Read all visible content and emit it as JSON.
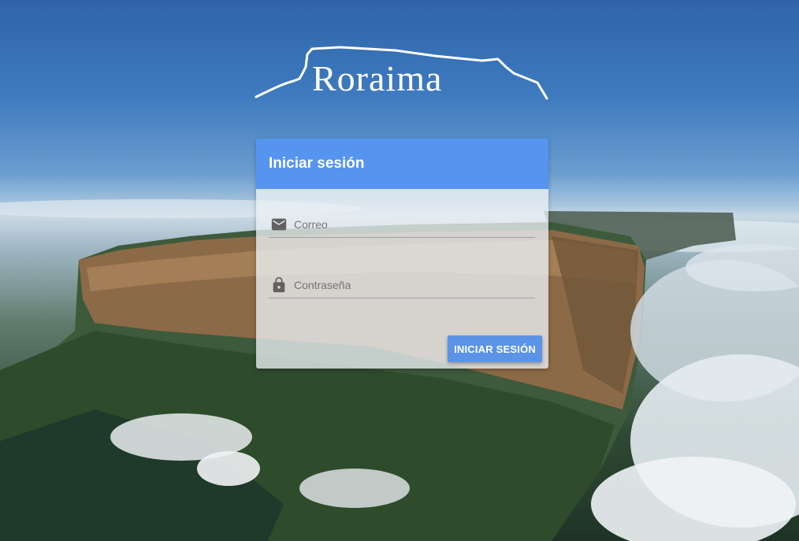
{
  "logo": {
    "text": "Roraima"
  },
  "login": {
    "title": "Iniciar sesión",
    "email_placeholder": "Correo",
    "password_placeholder": "Contraseña",
    "submit_label": "INICIAR SESIÓN"
  },
  "icons": {
    "email": "mail-icon",
    "password": "lock-icon"
  },
  "colors": {
    "header": "#5594ef",
    "button": "#5b93e6"
  }
}
